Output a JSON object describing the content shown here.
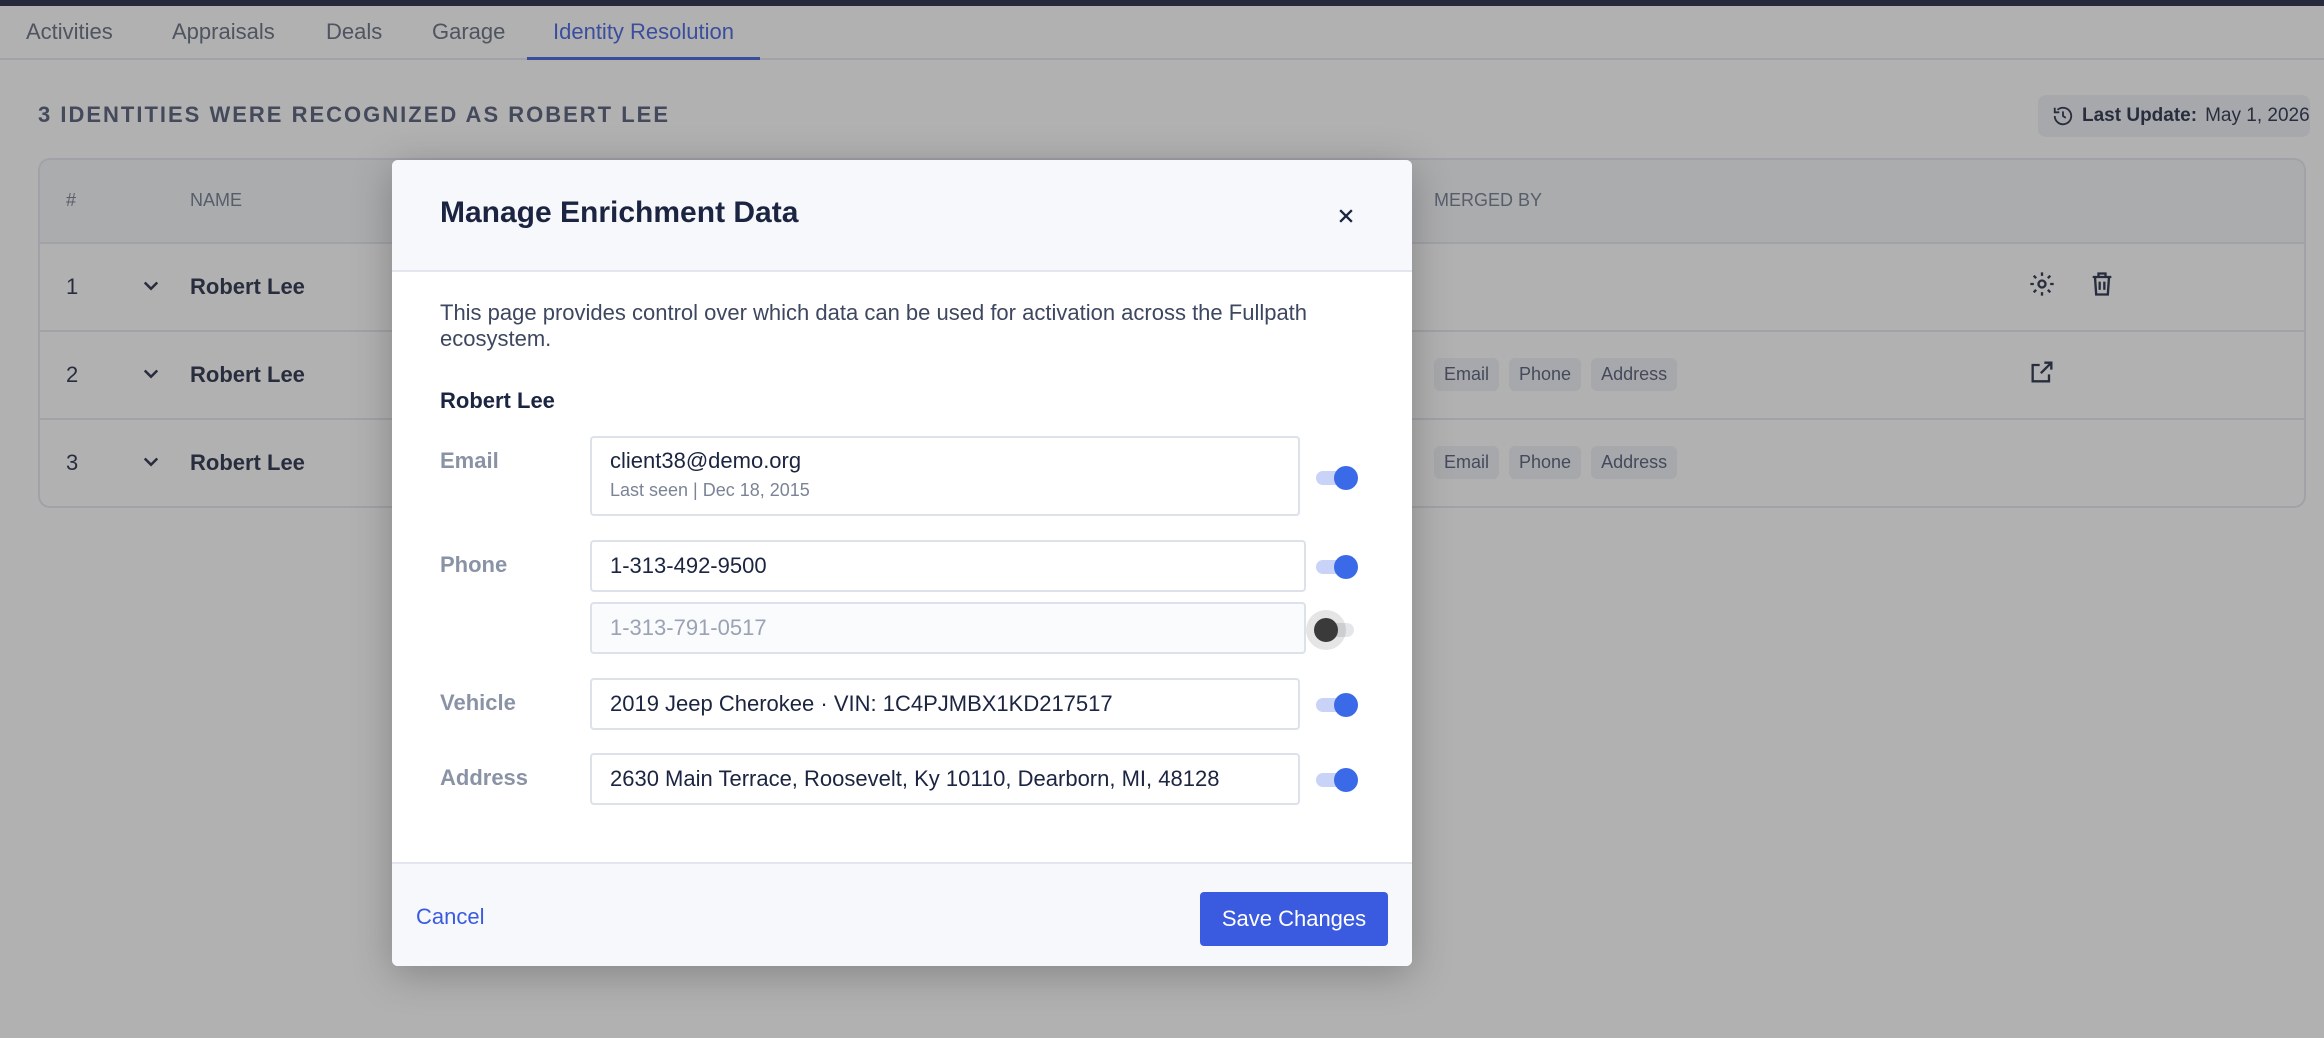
{
  "tabs": [
    {
      "label": "Activities"
    },
    {
      "label": "Appraisals"
    },
    {
      "label": "Deals"
    },
    {
      "label": "Garage"
    },
    {
      "label": "Identity Resolution"
    }
  ],
  "heading": "3 IDENTITIES WERE RECOGNIZED AS ROBERT LEE",
  "last_update": {
    "label": "Last Update:",
    "value": "May 1, 2026",
    "icon": "history-icon"
  },
  "table": {
    "columns": {
      "num": "#",
      "name": "NAME",
      "merged_by": "MERGED BY"
    },
    "rows": [
      {
        "num": "1",
        "name": "Robert Lee",
        "chips": []
      },
      {
        "num": "2",
        "name": "Robert Lee",
        "chips": [
          "Email",
          "Phone",
          "Address"
        ]
      },
      {
        "num": "3",
        "name": "Robert Lee",
        "chips": [
          "Email",
          "Phone",
          "Address"
        ]
      }
    ]
  },
  "modal": {
    "title": "Manage Enrichment Data",
    "description": "This page provides control over which data can be used for activation across the Fullpath ecosystem.",
    "person": "Robert Lee",
    "fields": {
      "email": {
        "label": "Email",
        "value": "client38@demo.org",
        "sub": "Last seen | Dec 18, 2015",
        "enabled": true
      },
      "phone": {
        "label": "Phone",
        "values": [
          {
            "value": "1-313-492-9500",
            "enabled": true
          },
          {
            "value": "1-313-791-0517",
            "enabled": false
          }
        ]
      },
      "vehicle": {
        "label": "Vehicle",
        "value": "2019 Jeep Cherokee · VIN: 1C4PJMBX1KD217517",
        "enabled": true
      },
      "address": {
        "label": "Address",
        "value": "2630 Main Terrace, Roosevelt, Ky 10110, Dearborn, MI, 48128",
        "enabled": true
      }
    },
    "cancel_label": "Cancel",
    "save_label": "Save Changes"
  }
}
